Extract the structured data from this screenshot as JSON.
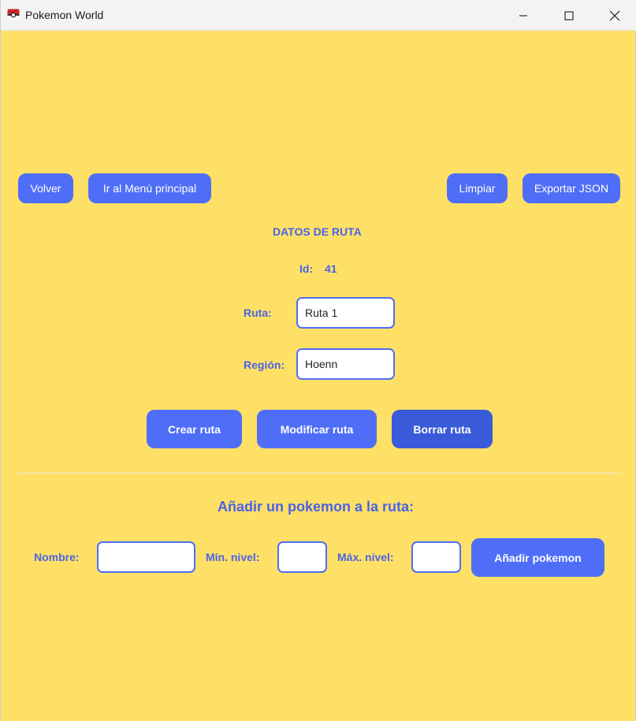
{
  "window": {
    "title": "Pokemon World"
  },
  "toolbar": {
    "back_label": "Volver",
    "main_menu_label": "Ir al Menú principal",
    "clear_label": "Limpiar",
    "export_label": "Exportar JSON"
  },
  "route": {
    "heading": "DATOS DE RUTA",
    "id_label": "Id:",
    "id_value": "41",
    "name_label": "Ruta:",
    "name_value": "Ruta 1",
    "region_label": "Región:",
    "region_value": "Hoenn"
  },
  "actions": {
    "create_label": "Crear ruta",
    "modify_label": "Modificar ruta",
    "delete_label": "Borrar ruta"
  },
  "add_pokemon": {
    "heading": "Añadir un pokemon a la ruta:",
    "name_label": "Nombre:",
    "name_value": "",
    "min_level_label": "Mín. nivel:",
    "min_level_value": "",
    "max_level_label": "Máx. nivel:",
    "max_level_value": "",
    "add_label": "Añadir pokemon"
  },
  "colors": {
    "background": "#ffe066",
    "accent": "#4f6ef7",
    "accent_dark": "#3a5bd9",
    "label": "#4a63e6"
  },
  "icons": {
    "app": "pokeball-icon",
    "minimize": "minimize-icon",
    "maximize": "maximize-icon",
    "close": "close-icon"
  }
}
